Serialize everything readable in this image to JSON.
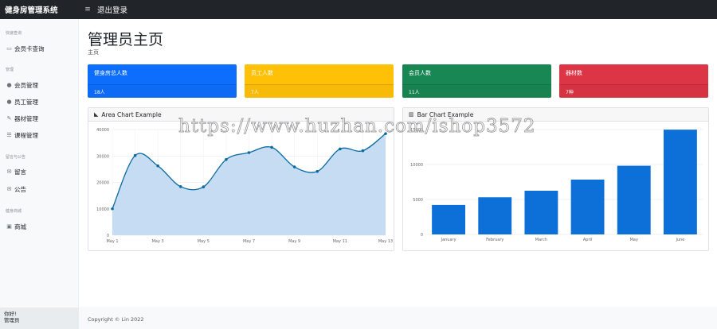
{
  "header": {
    "brand": "健身房管理系统",
    "logout": "退出登录"
  },
  "sidebar": {
    "sections": [
      {
        "heading": "快速查询",
        "items": [
          {
            "label": "会员卡查询",
            "icon": "card-icon"
          }
        ]
      },
      {
        "heading": "管理",
        "items": [
          {
            "label": "会员管理",
            "icon": "user-icon"
          },
          {
            "label": "员工管理",
            "icon": "user-icon"
          },
          {
            "label": "器材管理",
            "icon": "wrench-icon"
          },
          {
            "label": "课程管理",
            "icon": "list-icon"
          }
        ]
      },
      {
        "heading": "留言与公告",
        "items": [
          {
            "label": "留言",
            "icon": "comment-icon"
          },
          {
            "label": "公告",
            "icon": "comment-icon"
          }
        ]
      },
      {
        "heading": "健身商城",
        "items": [
          {
            "label": "商城",
            "icon": "shop-icon"
          }
        ]
      }
    ],
    "footer": {
      "greeting": "你好!",
      "user": "管理员"
    }
  },
  "main": {
    "title": "管理员主页",
    "breadcrumb": "主页",
    "cards": [
      {
        "title": "健身房总人数",
        "value": "18人",
        "color": "#0d6efd"
      },
      {
        "title": "员工人数",
        "value": "7人",
        "color": "#ffc107"
      },
      {
        "title": "会员人数",
        "value": "11人",
        "color": "#198754"
      },
      {
        "title": "器材数",
        "value": "7种",
        "color": "#dc3545"
      }
    ],
    "area_panel_title": "Area Chart Example",
    "bar_panel_title": "Bar Chart Example"
  },
  "footer": {
    "copyright": "Copyright © Lin 2022"
  },
  "watermark": "https://www.huzhan.com/ishop3572",
  "chart_data": [
    {
      "type": "area",
      "categories": [
        "May 1",
        "May 2",
        "May 3",
        "May 4",
        "May 5",
        "May 6",
        "May 7",
        "May 8",
        "May 9",
        "May 10",
        "May 11",
        "May 12",
        "May 13"
      ],
      "x_tick_labels": [
        "May 1",
        "May 3",
        "May 5",
        "May 7",
        "May 9",
        "May 11",
        "May 13"
      ],
      "values": [
        10000,
        30162,
        26263,
        18394,
        18287,
        28682,
        31274,
        33259,
        25849,
        24159,
        32651,
        31984,
        38451
      ],
      "ylim": [
        0,
        40000
      ],
      "y_ticks": [
        0,
        10000,
        20000,
        30000,
        40000
      ],
      "grid": true,
      "line_color": "#0a6aa1",
      "fill_color": "#c6dcf2"
    },
    {
      "type": "bar",
      "categories": [
        "January",
        "February",
        "March",
        "April",
        "May",
        "June"
      ],
      "values": [
        4215,
        5312,
        6251,
        7841,
        9821,
        14984
      ],
      "ylim": [
        0,
        15000
      ],
      "y_ticks": [
        0,
        5000,
        10000,
        15000
      ],
      "grid": true,
      "bar_color": "#0d6fd8"
    }
  ]
}
